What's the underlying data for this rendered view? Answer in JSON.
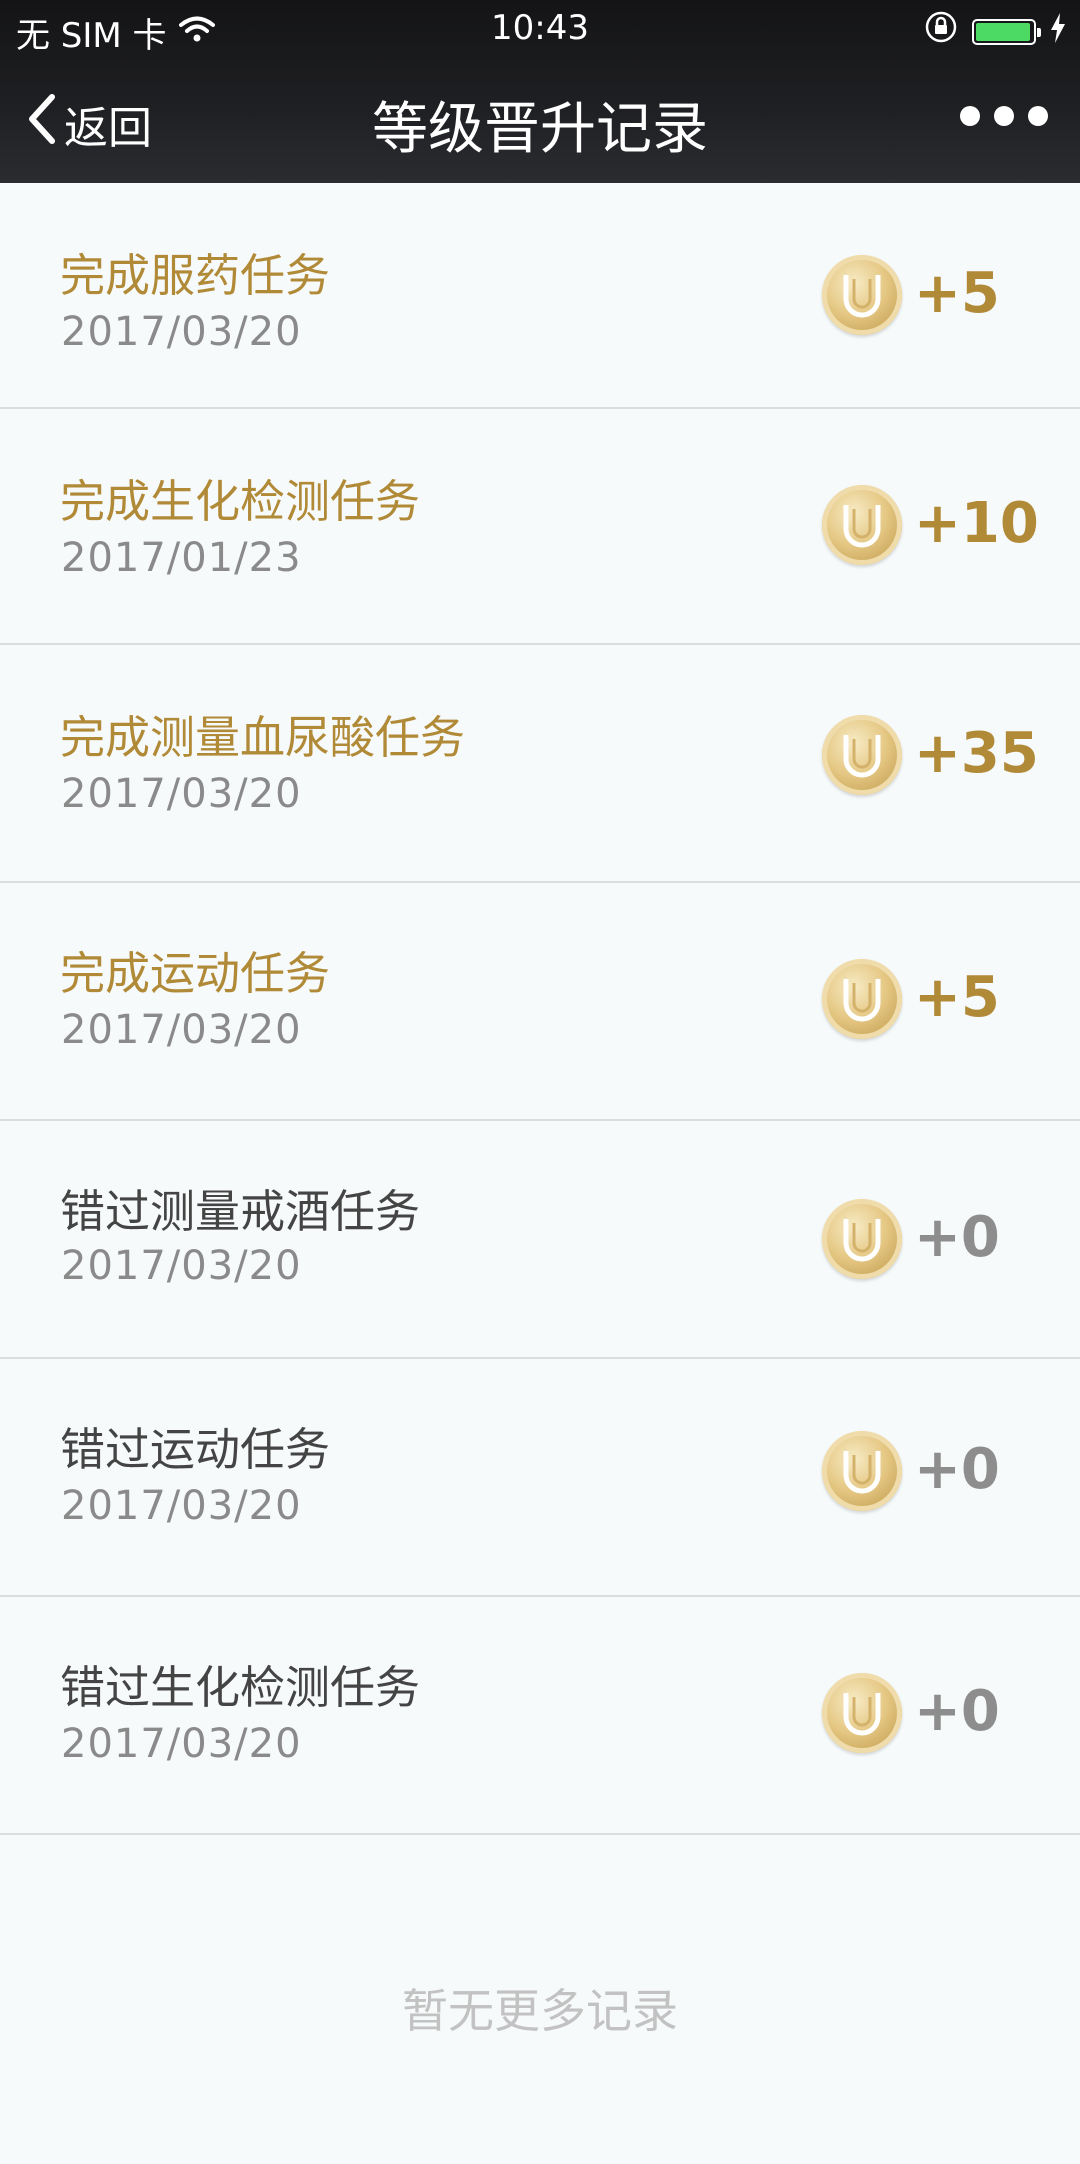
{
  "status_bar": {
    "carrier": "无 SIM 卡",
    "time": "10:43",
    "battery_color": "#4cd964"
  },
  "nav": {
    "back_label": "返回",
    "title": "等级晋升记录",
    "more_icon": "more-dots-icon"
  },
  "records": [
    {
      "name": "完成服药任务",
      "date": "2017/03/20",
      "points": "+5",
      "status": "earned"
    },
    {
      "name": "完成生化检测任务",
      "date": "2017/01/23",
      "points": "+10",
      "status": "earned"
    },
    {
      "name": "完成测量血尿酸任务",
      "date": "2017/03/20",
      "points": "+35",
      "status": "earned"
    },
    {
      "name": "完成运动任务",
      "date": "2017/03/20",
      "points": "+5",
      "status": "earned"
    },
    {
      "name": "错过测量戒酒任务",
      "date": "2017/03/20",
      "points": "+0",
      "status": "missed"
    },
    {
      "name": "错过运动任务",
      "date": "2017/03/20",
      "points": "+0",
      "status": "missed"
    },
    {
      "name": "错过生化检测任务",
      "date": "2017/03/20",
      "points": "+0",
      "status": "missed"
    }
  ],
  "footer_text": "暂无更多记录",
  "colors": {
    "earned": "#b18a38",
    "missed_text": "#444444",
    "missed_points": "#8d8d8d",
    "header_bg": "#1f2023"
  }
}
